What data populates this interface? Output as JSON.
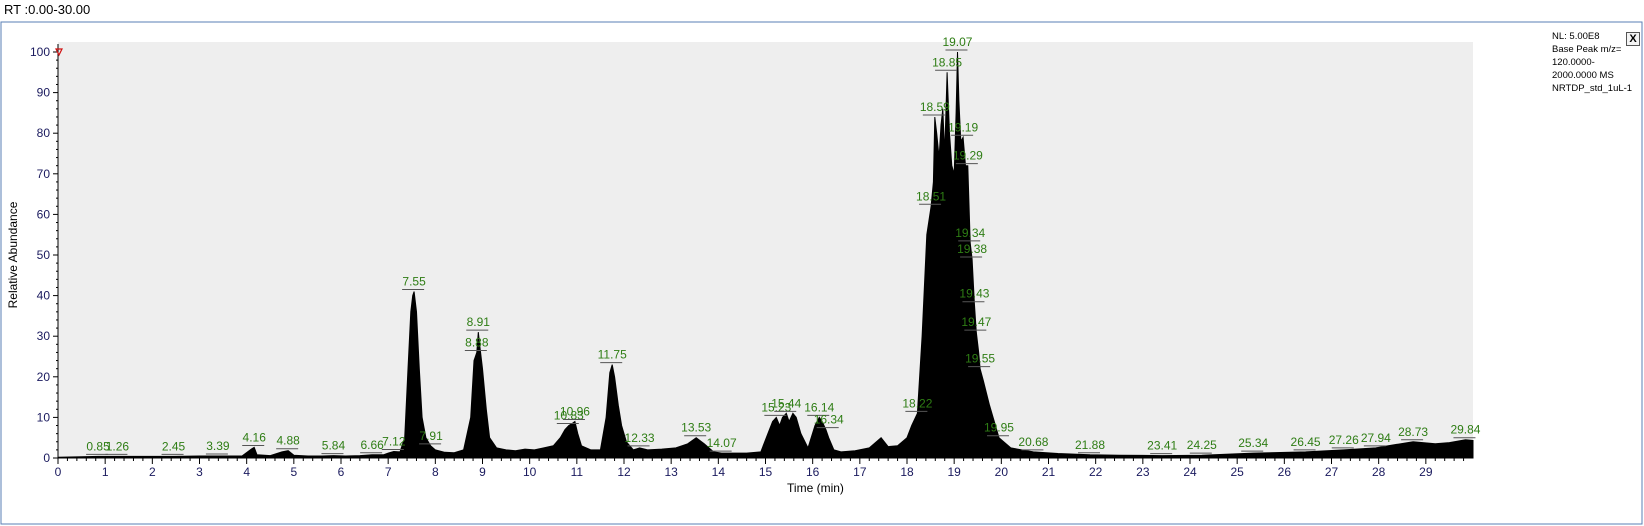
{
  "header": {
    "rt_label": "RT :0.00-30.00"
  },
  "info": {
    "lines": [
      "NL: 5.00E8",
      "Base Peak m/z=",
      "120.0000-",
      "2000.0000 MS",
      "NRTDP_std_1uL-1"
    ],
    "close_label": "X"
  },
  "colors": {
    "trace": "#000000",
    "peak_label": "#2e7d14",
    "axis_text": "#1a1a5e",
    "plot_bg": "#eeeeee"
  },
  "chart_data": {
    "type": "line",
    "xlabel": "Time (min)",
    "ylabel": "Relative Abundance",
    "xlim": [
      0,
      30
    ],
    "ylim": [
      0,
      100
    ],
    "x_ticks": [
      0,
      1,
      2,
      3,
      4,
      5,
      6,
      7,
      8,
      9,
      10,
      11,
      12,
      13,
      14,
      15,
      16,
      17,
      18,
      19,
      20,
      21,
      22,
      23,
      24,
      25,
      26,
      27,
      28,
      29
    ],
    "y_ticks": [
      0,
      10,
      20,
      30,
      40,
      50,
      60,
      70,
      80,
      90,
      100
    ],
    "grid": false,
    "series": [
      {
        "x": [
          0.0,
          0.5,
          0.85,
          1.26,
          2.0,
          2.45,
          3.0,
          3.39,
          3.9,
          4.1,
          4.16,
          4.22,
          4.5,
          4.75,
          4.88,
          5.0,
          5.3,
          5.6,
          5.84,
          6.1,
          6.4,
          6.66,
          6.9,
          7.0,
          7.12,
          7.25,
          7.35,
          7.42,
          7.48,
          7.52,
          7.55,
          7.6,
          7.66,
          7.72,
          7.8,
          7.9,
          8.0,
          8.2,
          8.4,
          8.6,
          8.75,
          8.82,
          8.88,
          8.91,
          8.95,
          9.0,
          9.08,
          9.15,
          9.3,
          9.5,
          9.7,
          9.9,
          10.1,
          10.3,
          10.5,
          10.65,
          10.75,
          10.83,
          10.9,
          10.96,
          11.02,
          11.1,
          11.3,
          11.5,
          11.62,
          11.7,
          11.75,
          11.8,
          11.88,
          11.95,
          12.05,
          12.2,
          12.33,
          12.5,
          12.8,
          13.1,
          13.35,
          13.53,
          13.7,
          13.9,
          14.07,
          14.3,
          14.6,
          14.9,
          15.05,
          15.15,
          15.23,
          15.3,
          15.36,
          15.44,
          15.5,
          15.58,
          15.65,
          15.75,
          15.9,
          16.05,
          16.14,
          16.2,
          16.28,
          16.34,
          16.45,
          16.6,
          16.9,
          17.2,
          17.45,
          17.6,
          17.8,
          18.0,
          18.1,
          18.22,
          18.32,
          18.42,
          18.51,
          18.56,
          18.59,
          18.63,
          18.68,
          18.72,
          18.76,
          18.8,
          18.85,
          18.9,
          18.95,
          19.0,
          19.04,
          19.07,
          19.1,
          19.14,
          19.19,
          19.24,
          19.29,
          19.34,
          19.38,
          19.43,
          19.47,
          19.52,
          19.55,
          19.62,
          19.75,
          19.95,
          20.2,
          20.68,
          21.2,
          21.88,
          22.5,
          23.41,
          24.25,
          25.34,
          26.45,
          27.26,
          27.94,
          28.3,
          28.73,
          29.2,
          29.5,
          29.84,
          30.0
        ],
        "y": [
          0.2,
          0.3,
          0.4,
          0.4,
          0.4,
          0.4,
          0.5,
          0.5,
          0.5,
          2.2,
          2.6,
          0.8,
          0.6,
          1.5,
          1.8,
          0.7,
          0.5,
          0.5,
          0.6,
          0.5,
          0.6,
          0.8,
          0.8,
          1.2,
          1.6,
          1.5,
          5,
          22,
          36,
          40,
          41,
          36,
          22,
          10,
          5,
          3,
          2,
          1.4,
          1.3,
          2,
          10,
          24,
          26,
          31,
          27,
          22,
          12,
          5,
          2.5,
          2,
          1.8,
          2.2,
          2,
          2.5,
          3,
          5,
          7,
          8,
          8.5,
          9,
          6,
          3,
          2,
          2,
          10,
          21,
          23,
          20,
          13,
          8,
          4,
          2,
          2.5,
          2,
          2.2,
          2.5,
          3.5,
          5,
          3.5,
          1.5,
          1.2,
          1.2,
          1.2,
          1.5,
          6,
          9,
          10,
          8,
          10,
          11,
          9,
          11,
          10,
          6,
          2.5,
          8,
          10,
          9,
          7,
          5,
          2,
          1.5,
          1.8,
          2.5,
          5,
          2.8,
          3,
          5,
          8,
          11,
          30,
          55,
          62,
          68,
          84,
          80,
          74,
          82,
          86,
          75,
          95,
          80,
          72,
          70,
          85,
          100,
          88,
          78,
          79,
          72,
          72,
          53,
          49,
          38,
          31,
          26,
          22,
          19,
          13,
          5,
          2.5,
          1.5,
          1.1,
          0.8,
          0.7,
          0.6,
          0.7,
          1.2,
          1.5,
          2,
          2.5,
          3.2,
          4,
          3.5,
          3.8,
          4.5,
          4.3
        ]
      }
    ],
    "annotations": [
      {
        "label": "0.85",
        "x": 0.85,
        "y": 0.4
      },
      {
        "label": "1.26",
        "x": 1.26,
        "y": 0.4
      },
      {
        "label": "2.45",
        "x": 2.45,
        "y": 0.4
      },
      {
        "label": "3.39",
        "x": 3.39,
        "y": 0.5
      },
      {
        "label": "4.16",
        "x": 4.16,
        "y": 2.6
      },
      {
        "label": "4.88",
        "x": 4.88,
        "y": 1.8
      },
      {
        "label": "5.84",
        "x": 5.84,
        "y": 0.6
      },
      {
        "label": "6.66",
        "x": 6.66,
        "y": 0.8
      },
      {
        "label": "7.12",
        "x": 7.12,
        "y": 1.6
      },
      {
        "label": "7.55",
        "x": 7.55,
        "y": 41
      },
      {
        "label": "7.91",
        "x": 7.91,
        "y": 3
      },
      {
        "label": "8.88",
        "x": 8.88,
        "y": 26
      },
      {
        "label": "8.91",
        "x": 8.91,
        "y": 31
      },
      {
        "label": "10.83",
        "x": 10.83,
        "y": 8
      },
      {
        "label": "10.96",
        "x": 10.96,
        "y": 9
      },
      {
        "label": "11.75",
        "x": 11.75,
        "y": 23
      },
      {
        "label": "12.33",
        "x": 12.33,
        "y": 2.5
      },
      {
        "label": "13.53",
        "x": 13.53,
        "y": 5
      },
      {
        "label": "14.07",
        "x": 14.07,
        "y": 1.2
      },
      {
        "label": "15.23",
        "x": 15.23,
        "y": 10
      },
      {
        "label": "15.44",
        "x": 15.44,
        "y": 11
      },
      {
        "label": "16.14",
        "x": 16.14,
        "y": 10
      },
      {
        "label": "16.34",
        "x": 16.34,
        "y": 7
      },
      {
        "label": "18.22",
        "x": 18.22,
        "y": 11
      },
      {
        "label": "18.51",
        "x": 18.51,
        "y": 62
      },
      {
        "label": "18.59",
        "x": 18.59,
        "y": 84
      },
      {
        "label": "18.85",
        "x": 18.85,
        "y": 95
      },
      {
        "label": "19.07",
        "x": 19.07,
        "y": 100
      },
      {
        "label": "19.19",
        "x": 19.19,
        "y": 79
      },
      {
        "label": "19.29",
        "x": 19.29,
        "y": 72
      },
      {
        "label": "19.34",
        "x": 19.34,
        "y": 53
      },
      {
        "label": "19.38",
        "x": 19.38,
        "y": 49
      },
      {
        "label": "19.43",
        "x": 19.43,
        "y": 38
      },
      {
        "label": "19.47",
        "x": 19.47,
        "y": 31
      },
      {
        "label": "19.55",
        "x": 19.55,
        "y": 22
      },
      {
        "label": "19.95",
        "x": 19.95,
        "y": 5
      },
      {
        "label": "20.68",
        "x": 20.68,
        "y": 1.5
      },
      {
        "label": "21.88",
        "x": 21.88,
        "y": 0.8
      },
      {
        "label": "23.41",
        "x": 23.41,
        "y": 0.6
      },
      {
        "label": "24.25",
        "x": 24.25,
        "y": 0.7
      },
      {
        "label": "25.34",
        "x": 25.34,
        "y": 1.2
      },
      {
        "label": "26.45",
        "x": 26.45,
        "y": 1.5
      },
      {
        "label": "27.26",
        "x": 27.26,
        "y": 2
      },
      {
        "label": "27.94",
        "x": 27.94,
        "y": 2.5
      },
      {
        "label": "28.73",
        "x": 28.73,
        "y": 4
      },
      {
        "label": "29.84",
        "x": 29.84,
        "y": 4.5
      }
    ]
  }
}
